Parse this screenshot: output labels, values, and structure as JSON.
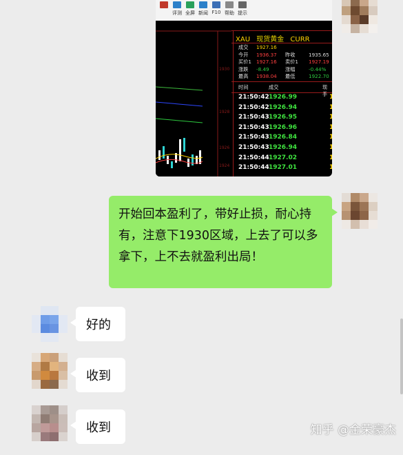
{
  "image_message": {
    "toolbar": [
      {
        "label": "",
        "icon": "chart-icon"
      },
      {
        "label": "评测",
        "icon": "review-icon"
      },
      {
        "label": "全屏",
        "icon": "fullscreen-icon"
      },
      {
        "label": "新闻",
        "icon": "news-icon"
      },
      {
        "label": "F10",
        "icon": "f10-icon"
      },
      {
        "label": "帮助",
        "icon": "help-icon"
      },
      {
        "label": "提示",
        "icon": "hint-icon"
      }
    ],
    "symbol": "XAU",
    "name": "现货黄金",
    "market": "CURR",
    "quote_rows": [
      {
        "l1": "成交",
        "v1": "1927.16",
        "l2": "",
        "v2": ""
      },
      {
        "l1": "今开",
        "v1": "1936.37",
        "l2": "昨收",
        "v2": "1935.65"
      },
      {
        "l1": "买价1",
        "v1": "1927.16",
        "l2": "卖价1",
        "v2": "1927.19"
      },
      {
        "l1": "涨跌",
        "v1": "-8.49",
        "l2": "涨幅",
        "v2": "-0.44%"
      },
      {
        "l1": "最高",
        "v1": "1938.04",
        "l2": "最低",
        "v2": "1922.70"
      }
    ],
    "tick_header": {
      "time": "时间",
      "price": "成交",
      "vol": "现手"
    },
    "ticks": [
      {
        "time": "21:50:42",
        "price": "1926.99"
      },
      {
        "time": "21:50:42",
        "price": "1926.94"
      },
      {
        "time": "21:50:43",
        "price": "1926.95"
      },
      {
        "time": "21:50:43",
        "price": "1926.96"
      },
      {
        "time": "21:50:43",
        "price": "1926.84"
      },
      {
        "time": "21:50:43",
        "price": "1926.94"
      },
      {
        "time": "21:50:44",
        "price": "1927.02"
      },
      {
        "time": "21:50:44",
        "price": "1927.01"
      }
    ]
  },
  "messages": {
    "sent_text": "开始回本盈利了，带好止损，耐心持有，注意下1930区域，上去了可以多拿下，上不去就盈利出局！",
    "replies": [
      "好的",
      "收到",
      "收到"
    ]
  },
  "watermark": "知乎 @金荣豪杰",
  "colors": {
    "sent_bubble": "#95ec69",
    "background": "#ececec",
    "ticker_yellow": "#ffd400",
    "up_red": "#ff4040",
    "down_green": "#2ecc40"
  }
}
